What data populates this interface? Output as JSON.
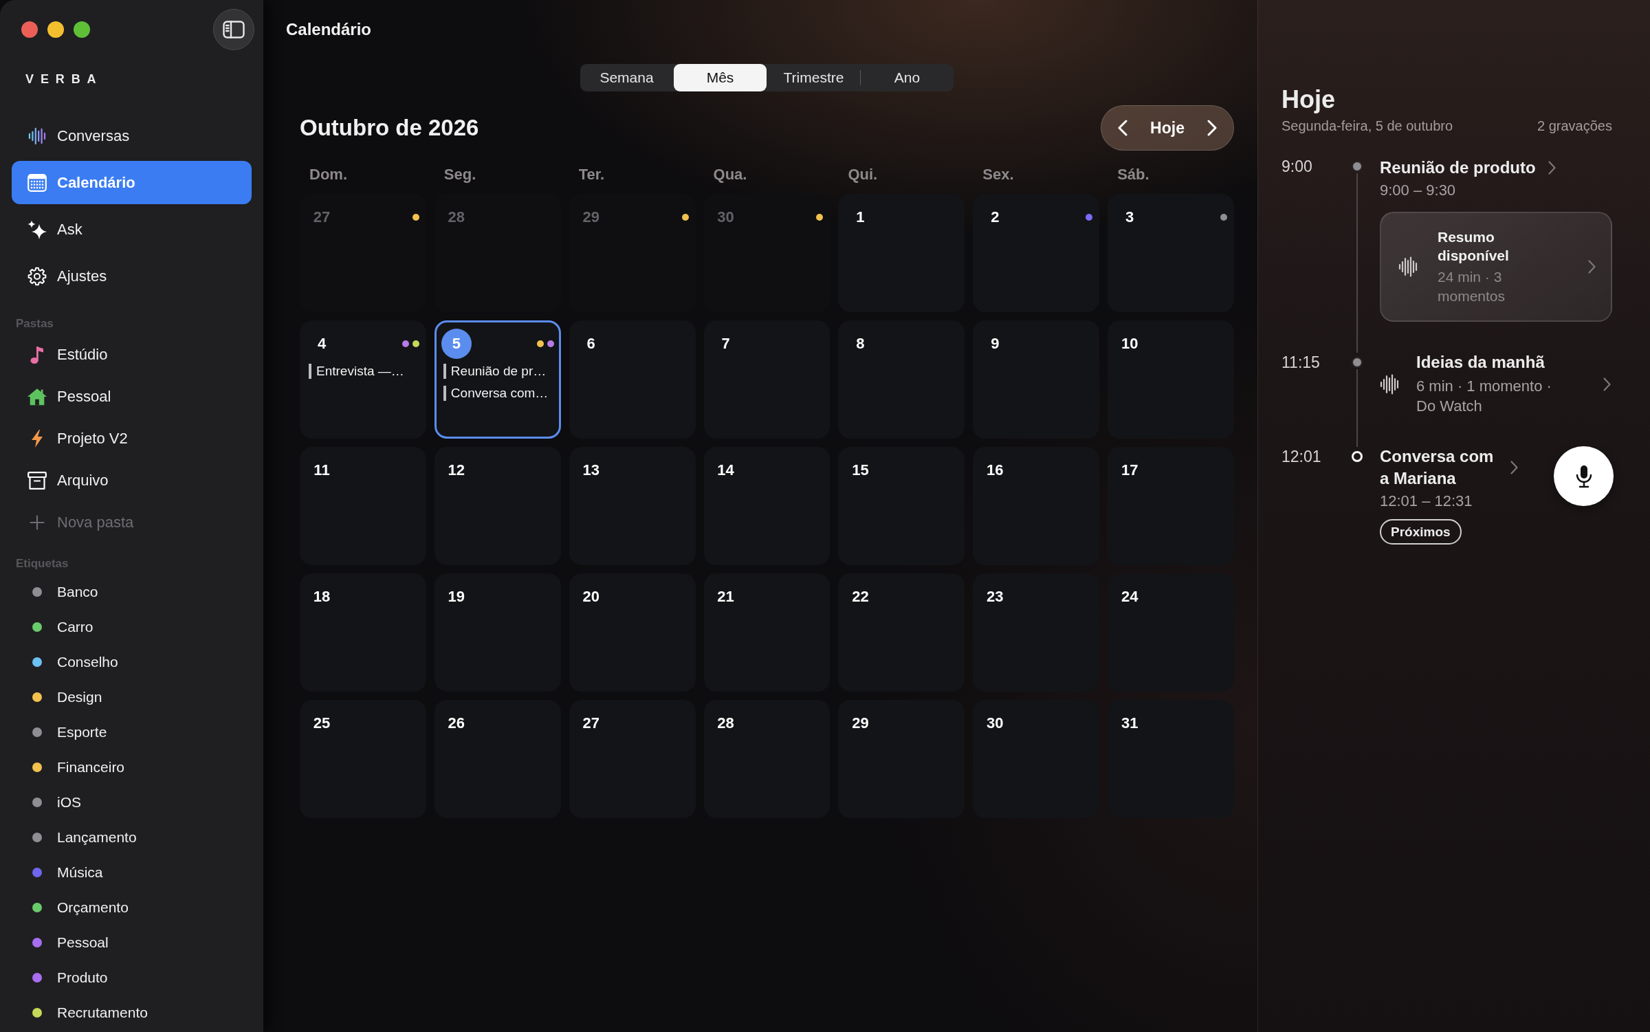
{
  "sidebar": {
    "logo": "VERBA",
    "nav": [
      {
        "label": "Conversas",
        "selected": false
      },
      {
        "label": "Calendário",
        "selected": true
      },
      {
        "label": "Ask",
        "selected": false
      },
      {
        "label": "Ajustes",
        "selected": false
      }
    ],
    "folders": {
      "title": "Pastas",
      "items": [
        {
          "label": "Estúdio"
        },
        {
          "label": "Pessoal"
        },
        {
          "label": "Projeto V2"
        },
        {
          "label": "Arquivo"
        }
      ],
      "new_item": "Nova pasta"
    },
    "tags": {
      "title": "Etiquetas",
      "items": [
        {
          "label": "Banco",
          "color": "#8e8e93"
        },
        {
          "label": "Carro",
          "color": "#6acb6b"
        },
        {
          "label": "Conselho",
          "color": "#6cc0f2"
        },
        {
          "label": "Design",
          "color": "#f2c14e"
        },
        {
          "label": "Esporte",
          "color": "#8e8e93"
        },
        {
          "label": "Financeiro",
          "color": "#f2c14e"
        },
        {
          "label": "iOS",
          "color": "#8e8e93"
        },
        {
          "label": "Lançamento",
          "color": "#8e8e93"
        },
        {
          "label": "Música",
          "color": "#6e66ee"
        },
        {
          "label": "Orçamento",
          "color": "#6acb6b"
        },
        {
          "label": "Pessoal",
          "color": "#a86ef0"
        },
        {
          "label": "Produto",
          "color": "#a86ef0"
        },
        {
          "label": "Recrutamento",
          "color": "#c6d85a"
        }
      ]
    }
  },
  "header": {
    "title": "Calendário"
  },
  "view_tabs": [
    {
      "label": "Semana",
      "selected": false
    },
    {
      "label": "Mês",
      "selected": true
    },
    {
      "label": "Trimestre",
      "selected": false
    },
    {
      "label": "Ano",
      "selected": false
    }
  ],
  "calendar": {
    "title": "Outubro de 2026",
    "today_button": "Hoje",
    "weekdays": [
      "Dom.",
      "Seg.",
      "Ter.",
      "Qua.",
      "Qui.",
      "Sex.",
      "Sáb."
    ],
    "days": [
      {
        "day": "27",
        "dimmed": true,
        "selected": false,
        "dots": [
          {
            "color": "#f2c14e"
          }
        ]
      },
      {
        "day": "28",
        "dimmed": true,
        "selected": false
      },
      {
        "day": "29",
        "dimmed": true,
        "selected": false,
        "dots": [
          {
            "color": "#f2c14e"
          }
        ]
      },
      {
        "day": "30",
        "dimmed": true,
        "selected": false,
        "dots": [
          {
            "color": "#f2c14e"
          }
        ]
      },
      {
        "day": "1",
        "dimmed": false,
        "selected": false
      },
      {
        "day": "2",
        "dimmed": false,
        "selected": false,
        "dots": [
          {
            "color": "#7b6cf6"
          }
        ]
      },
      {
        "day": "3",
        "dimmed": false,
        "selected": false,
        "dots": [
          {
            "color": "#8e8e93"
          }
        ]
      },
      {
        "day": "4",
        "dimmed": false,
        "selected": false,
        "dots": [
          {
            "color": "#b57be8"
          },
          {
            "color": "#c6d85a"
          }
        ],
        "events": [
          "Entrevista —…"
        ]
      },
      {
        "day": "5",
        "dimmed": false,
        "selected": true,
        "dots": [
          {
            "color": "#f2c14e"
          },
          {
            "color": "#b57be8"
          }
        ],
        "events": [
          "Reunião de pr…",
          "Conversa com…"
        ]
      },
      {
        "day": "6",
        "dimmed": false,
        "selected": false
      },
      {
        "day": "7",
        "dimmed": false,
        "selected": false
      },
      {
        "day": "8",
        "dimmed": false,
        "selected": false
      },
      {
        "day": "9",
        "dimmed": false,
        "selected": false
      },
      {
        "day": "10",
        "dimmed": false,
        "selected": false
      },
      {
        "day": "11",
        "dimmed": false,
        "selected": false
      },
      {
        "day": "12",
        "dimmed": false,
        "selected": false
      },
      {
        "day": "13",
        "dimmed": false,
        "selected": false
      },
      {
        "day": "14",
        "dimmed": false,
        "selected": false
      },
      {
        "day": "15",
        "dimmed": false,
        "selected": false
      },
      {
        "day": "16",
        "dimmed": false,
        "selected": false
      },
      {
        "day": "17",
        "dimmed": false,
        "selected": false
      },
      {
        "day": "18",
        "dimmed": false,
        "selected": false
      },
      {
        "day": "19",
        "dimmed": false,
        "selected": false
      },
      {
        "day": "20",
        "dimmed": false,
        "selected": false
      },
      {
        "day": "21",
        "dimmed": false,
        "selected": false
      },
      {
        "day": "22",
        "dimmed": false,
        "selected": false
      },
      {
        "day": "23",
        "dimmed": false,
        "selected": false
      },
      {
        "day": "24",
        "dimmed": false,
        "selected": false
      },
      {
        "day": "25",
        "dimmed": false,
        "selected": false
      },
      {
        "day": "26",
        "dimmed": false,
        "selected": false
      },
      {
        "day": "27",
        "dimmed": false,
        "selected": false
      },
      {
        "day": "28",
        "dimmed": false,
        "selected": false
      },
      {
        "day": "29",
        "dimmed": false,
        "selected": false
      },
      {
        "day": "30",
        "dimmed": false,
        "selected": false
      },
      {
        "day": "31",
        "dimmed": false,
        "selected": false
      }
    ]
  },
  "today": {
    "title": "Hoje",
    "date": "Segunda-feira, 5 de outubro",
    "count": "2 gravações",
    "entries": [
      {
        "time": "9:00",
        "kind": "event",
        "title": "Reunião de produto",
        "range": "9:00 – 9:30",
        "upcoming": false,
        "summary": {
          "title": "Resumo disponível",
          "meta": "24 min · 3 momentos"
        }
      },
      {
        "time": "11:15",
        "kind": "recording",
        "title": "Ideias da manhã",
        "meta": "6 min · 1 momento · Do Watch",
        "upcoming": false
      },
      {
        "time": "12:01",
        "kind": "event",
        "title": "Conversa com a Mariana",
        "range": "12:01 – 12:31",
        "upcoming": true,
        "badge": "Próximos"
      }
    ]
  }
}
